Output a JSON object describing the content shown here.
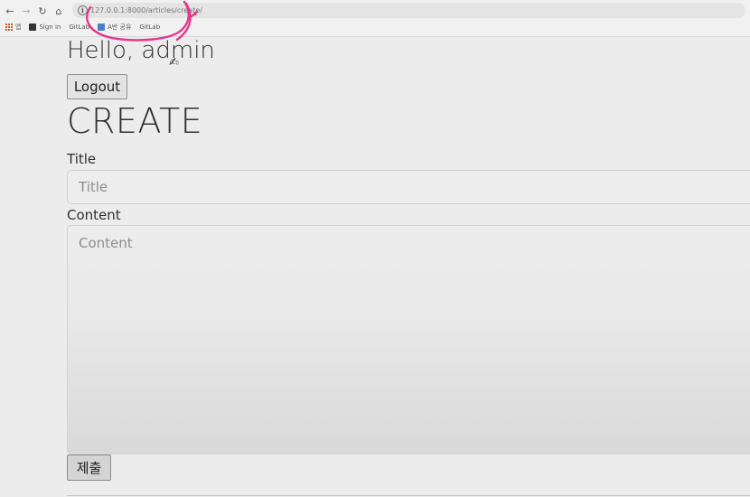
{
  "browser": {
    "url": "127.0.0.1:8000/articles/create/",
    "bookmarks": [
      "앱",
      "Sign in",
      "GitLab",
      "A반 공유",
      "GitLab"
    ]
  },
  "page": {
    "greeting": "Hello, admin",
    "logout_label": "Logout",
    "heading": "CREATE",
    "form": {
      "title_label": "Title",
      "title_placeholder": "Title",
      "content_label": "Content",
      "content_placeholder": "Content",
      "submit_label": "제출"
    }
  },
  "colors": {
    "annotation": "#e8348a",
    "background": "#ececec"
  },
  "icons": {
    "back": "arrow-left-icon",
    "forward": "arrow-right-icon",
    "reload": "reload-icon",
    "home": "home-icon",
    "site_info": "info-icon",
    "apps": "apps-grid-icon"
  }
}
